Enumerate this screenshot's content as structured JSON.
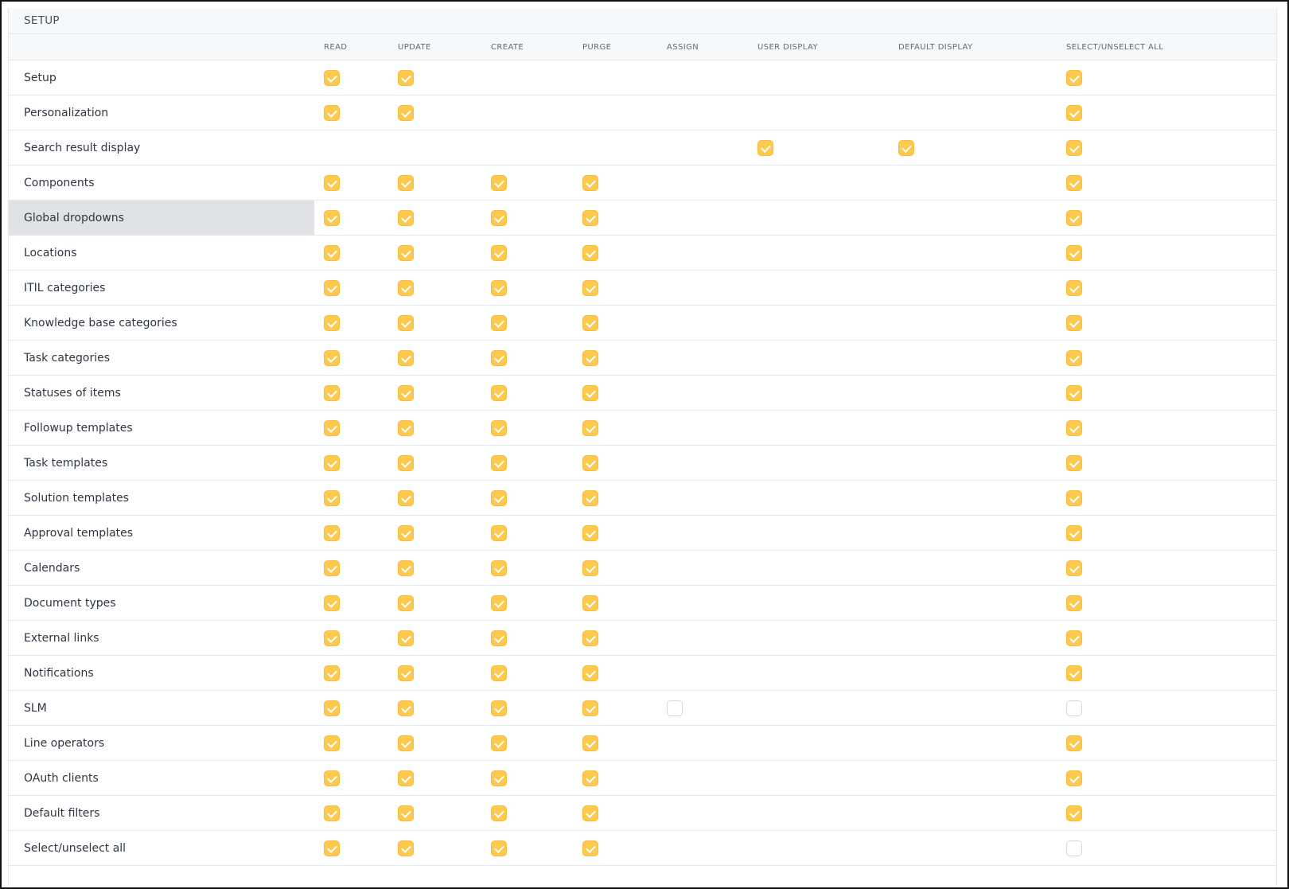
{
  "section": {
    "title": "SETUP"
  },
  "columns": [
    {
      "key": "read",
      "label": "READ"
    },
    {
      "key": "update",
      "label": "UPDATE"
    },
    {
      "key": "create",
      "label": "CREATE"
    },
    {
      "key": "purge",
      "label": "PURGE"
    },
    {
      "key": "assign",
      "label": "ASSIGN"
    },
    {
      "key": "user_display",
      "label": "USER DISPLAY"
    },
    {
      "key": "default_display",
      "label": "DEFAULT DISPLAY"
    },
    {
      "key": "select_all",
      "label": "SELECT/UNSELECT ALL"
    }
  ],
  "rows": [
    {
      "label": "Setup",
      "cells": [
        "on",
        "on",
        "",
        "",
        "",
        "",
        "",
        "on"
      ]
    },
    {
      "label": "Personalization",
      "cells": [
        "on",
        "on",
        "",
        "",
        "",
        "",
        "",
        "on"
      ]
    },
    {
      "label": "Search result display",
      "cells": [
        "",
        "",
        "",
        "",
        "",
        "on",
        "on",
        "on"
      ]
    },
    {
      "label": "Components",
      "cells": [
        "on",
        "on",
        "on",
        "on",
        "",
        "",
        "",
        "on"
      ]
    },
    {
      "label": "Global dropdowns",
      "cells": [
        "on",
        "on",
        "on",
        "on",
        "",
        "",
        "",
        "on"
      ],
      "highlight": true
    },
    {
      "label": "Locations",
      "cells": [
        "on",
        "on",
        "on",
        "on",
        "",
        "",
        "",
        "on"
      ]
    },
    {
      "label": "ITIL categories",
      "cells": [
        "on",
        "on",
        "on",
        "on",
        "",
        "",
        "",
        "on"
      ]
    },
    {
      "label": "Knowledge base categories",
      "cells": [
        "on",
        "on",
        "on",
        "on",
        "",
        "",
        "",
        "on"
      ]
    },
    {
      "label": "Task categories",
      "cells": [
        "on",
        "on",
        "on",
        "on",
        "",
        "",
        "",
        "on"
      ]
    },
    {
      "label": "Statuses of items",
      "cells": [
        "on",
        "on",
        "on",
        "on",
        "",
        "",
        "",
        "on"
      ]
    },
    {
      "label": "Followup templates",
      "cells": [
        "on",
        "on",
        "on",
        "on",
        "",
        "",
        "",
        "on"
      ]
    },
    {
      "label": "Task templates",
      "cells": [
        "on",
        "on",
        "on",
        "on",
        "",
        "",
        "",
        "on"
      ]
    },
    {
      "label": "Solution templates",
      "cells": [
        "on",
        "on",
        "on",
        "on",
        "",
        "",
        "",
        "on"
      ]
    },
    {
      "label": "Approval templates",
      "cells": [
        "on",
        "on",
        "on",
        "on",
        "",
        "",
        "",
        "on"
      ]
    },
    {
      "label": "Calendars",
      "cells": [
        "on",
        "on",
        "on",
        "on",
        "",
        "",
        "",
        "on"
      ]
    },
    {
      "label": "Document types",
      "cells": [
        "on",
        "on",
        "on",
        "on",
        "",
        "",
        "",
        "on"
      ]
    },
    {
      "label": "External links",
      "cells": [
        "on",
        "on",
        "on",
        "on",
        "",
        "",
        "",
        "on"
      ]
    },
    {
      "label": "Notifications",
      "cells": [
        "on",
        "on",
        "on",
        "on",
        "",
        "",
        "",
        "on"
      ]
    },
    {
      "label": "SLM",
      "cells": [
        "on",
        "on",
        "on",
        "on",
        "off",
        "",
        "",
        "off"
      ]
    },
    {
      "label": "Line operators",
      "cells": [
        "on",
        "on",
        "on",
        "on",
        "",
        "",
        "",
        "on"
      ]
    },
    {
      "label": "OAuth clients",
      "cells": [
        "on",
        "on",
        "on",
        "on",
        "",
        "",
        "",
        "on"
      ]
    },
    {
      "label": "Default filters",
      "cells": [
        "on",
        "on",
        "on",
        "on",
        "",
        "",
        "",
        "on"
      ]
    },
    {
      "label": "Select/unselect all",
      "cells": [
        "on",
        "on",
        "on",
        "on",
        "",
        "",
        "",
        "off"
      ]
    }
  ],
  "colors": {
    "checked_fill": "#fdc94f",
    "checked_border": "#f5bd3a",
    "unchecked_border": "#d5d8dc",
    "header_bg": "#f7f8fa",
    "highlight_bg": "#e1e2e5"
  }
}
